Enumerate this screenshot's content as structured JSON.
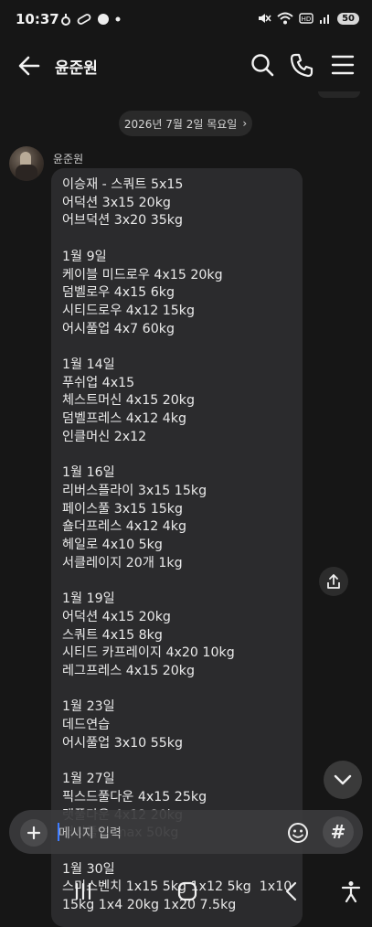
{
  "status": {
    "time": "10:37",
    "battery": "50"
  },
  "header": {
    "title": "윤준원"
  },
  "chat": {
    "date_divider": "2026년 7월 2일 목요일",
    "date_chevron": "›",
    "sender_name": "윤준원",
    "message": "이승재 - 스쿼트 5x15\n어덕션 3x15 20kg\n어브덕션 3x20 35kg\n\n1월 9일\n케이블 미드로우 4x15 20kg\n덤벨로우 4x15 6kg\n시티드로우 4x12 15kg\n어시풀업 4x7 60kg\n\n1월 14일\n푸쉬업 4x15\n체스트머신 4x15 20kg\n덤벨프레스 4x12 4kg\n인클머신 2x12\n\n1월 16일\n리버스플라이 3x15 15kg\n페이스풀 3x15 15kg\n숄더프레스 4x12 4kg\n헤일로 4x10 5kg\n서클레이지 20개 1kg\n\n1월 19일\n어덕션 4x15 20kg\n스쿼트 4x15 8kg\n시티드 카프레이지 4x20 10kg\n레그프레스 4x15 20kg\n\n1월 23일\n데드연습\n어시풀업 3x10 55kg\n\n1월 27일\n픽스드풀다운 4x15 25kg\n랫풀다운 4x12 20kg\n어시풀업 max 50kg\n\n1월 30일\n스미스벤치 1x15 5kg 1x12 5kg  1x10\n15kg 1x4 20kg 1x20 7.5kg"
  },
  "composer": {
    "placeholder": "메시지 입력",
    "hash_label": "#"
  },
  "icons": {
    "back": "back-arrow-icon",
    "search": "search-icon",
    "call": "phone-icon",
    "menu": "menu-icon",
    "share": "share-icon",
    "scroll_down": "chevron-down-icon",
    "plus": "plus-icon",
    "emoji": "emoji-icon"
  },
  "colors": {
    "background": "#161616",
    "bubble": "#2b2b2d",
    "caret": "#3d7bff"
  }
}
